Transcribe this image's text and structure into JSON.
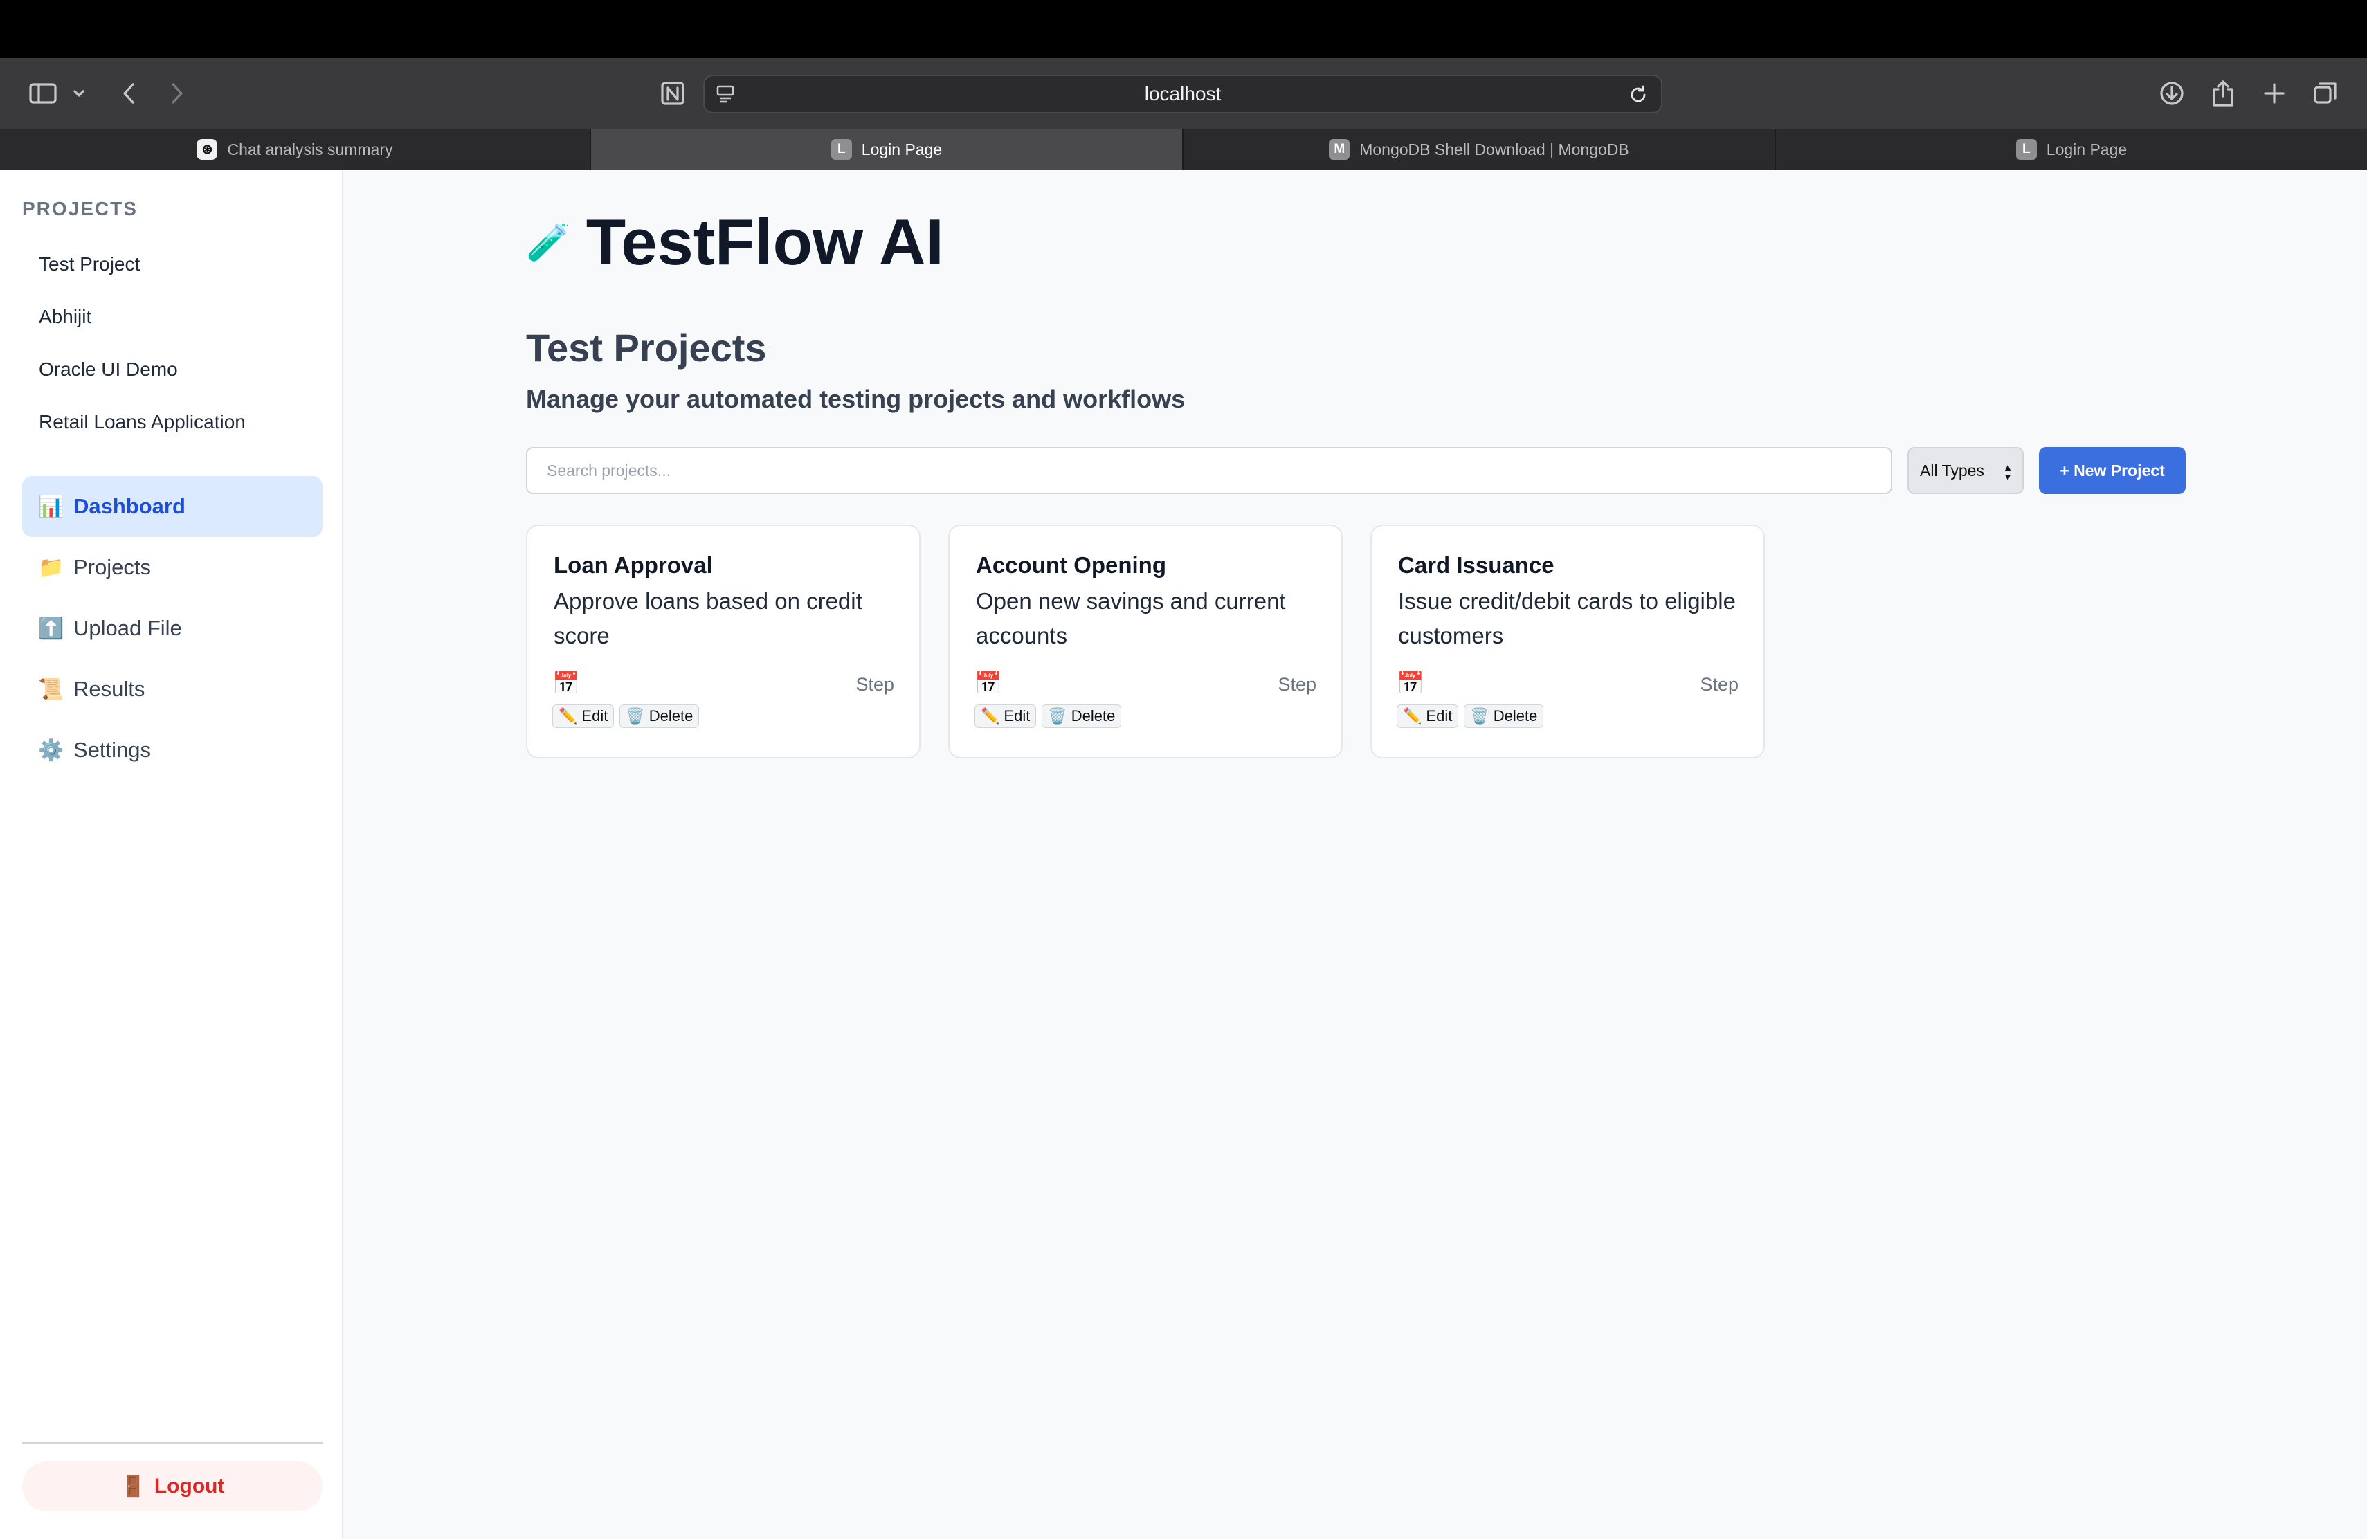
{
  "browser": {
    "url": "localhost",
    "tabs": [
      {
        "label": "Chat analysis summary",
        "favicon": "chatgpt-icon"
      },
      {
        "label": "Login Page",
        "favicon": "L"
      },
      {
        "label": "MongoDB Shell Download | MongoDB",
        "favicon": "M"
      },
      {
        "label": "Login Page",
        "favicon": "L"
      }
    ],
    "active_tab": 1
  },
  "sidebar": {
    "heading": "PROJECTS",
    "projects": [
      "Test Project",
      "Abhijit",
      "Oracle UI Demo",
      "Retail Loans Application"
    ],
    "nav": [
      {
        "label": "Dashboard",
        "icon": "📊",
        "active": true
      },
      {
        "label": "Projects",
        "icon": "📁"
      },
      {
        "label": "Upload File",
        "icon": "⬆️"
      },
      {
        "label": "Results",
        "icon": "📜"
      },
      {
        "label": "Settings",
        "icon": "⚙️"
      }
    ],
    "logout": {
      "label": "Logout",
      "icon": "🚪"
    }
  },
  "main": {
    "app_title": "TestFlow AI",
    "app_icon": "🧪",
    "heading": "Test Projects",
    "subtitle": "Manage your automated testing projects and workflows",
    "search_placeholder": "Search projects...",
    "type_filter": "All Types",
    "new_button": "+ New Project"
  },
  "cards": [
    {
      "title": "Loan Approval",
      "description": "Approve loans based on credit score",
      "type": "Step",
      "edit": "Edit",
      "delete": "Delete"
    },
    {
      "title": "Account Opening",
      "description": "Open new savings and current accounts",
      "type": "Step",
      "edit": "Edit",
      "delete": "Delete"
    },
    {
      "title": "Card Issuance",
      "description": "Issue credit/debit cards to eligible customers",
      "type": "Step",
      "edit": "Edit",
      "delete": "Delete"
    }
  ],
  "colors": {
    "primary": "#3b6fe0",
    "active_nav_bg": "#dbeafe",
    "logout": "#dc2626"
  }
}
